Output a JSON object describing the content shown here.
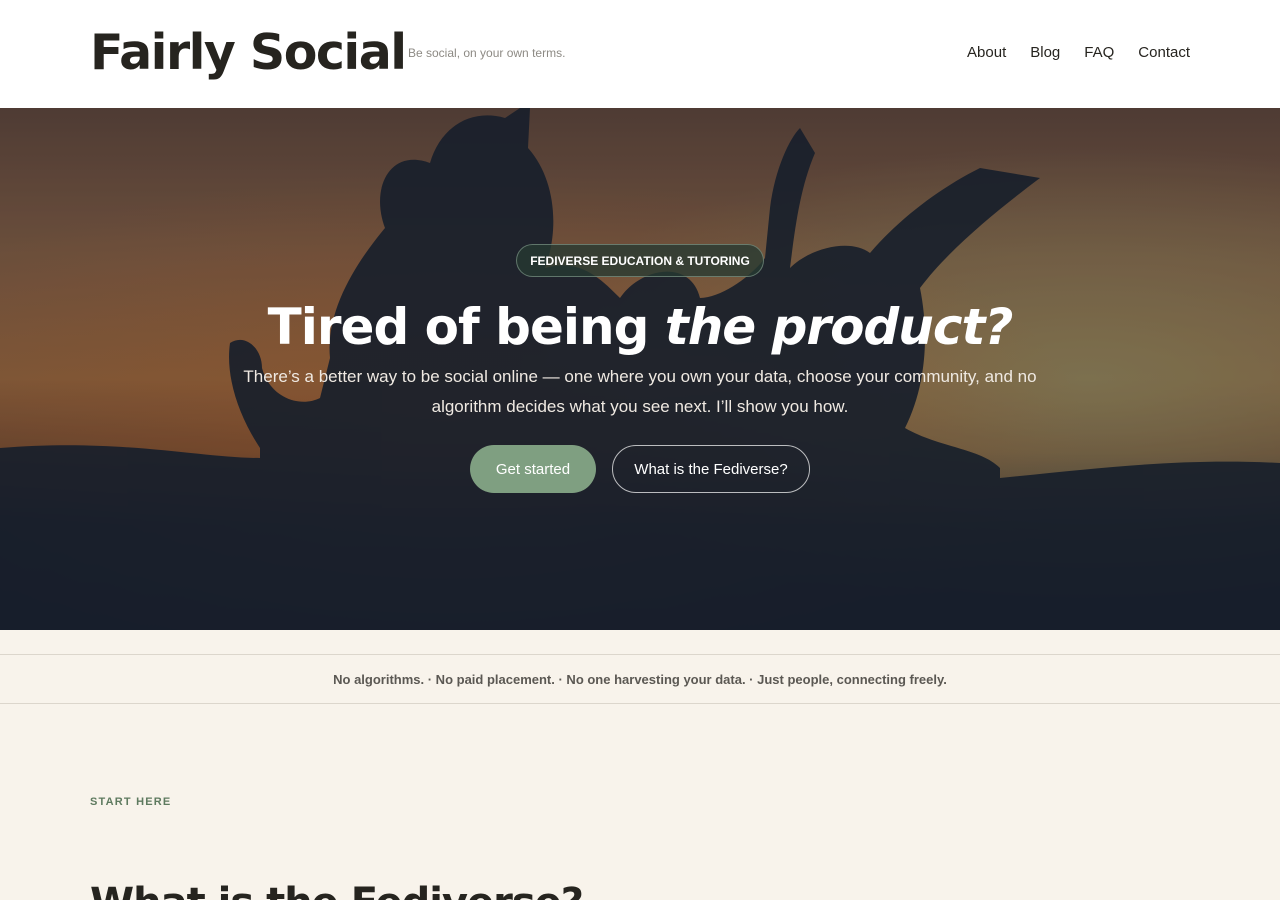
{
  "header": {
    "site_title": "Fairly Social",
    "tagline": "Be social, on your own terms.",
    "nav": [
      {
        "label": "About"
      },
      {
        "label": "Blog"
      },
      {
        "label": "FAQ"
      },
      {
        "label": "Contact"
      }
    ]
  },
  "hero": {
    "eyebrow": "FEDIVERSE EDUCATION & TUTORING",
    "title_plain": "Tired of being ",
    "title_italic": "the product?",
    "lead": "There’s a better way to be social online — one where you own your data, choose your community, and no algorithm decides what you see next. I’ll show you how.",
    "primary_button": "Get started",
    "secondary_button": "What is the Fediverse?",
    "background_image": "silhouettes-sunset-photo"
  },
  "values_strip": {
    "text": "No algorithms. · No paid placement. · No one harvesting your data. · Just people, connecting freely."
  },
  "intro_section": {
    "eyebrow": "START HERE",
    "title": "What is the Fediverse?"
  },
  "colors": {
    "accent": "#7f9f81",
    "header_bg": "#ffffff",
    "page_bg": "#f8f3eb",
    "hero_dark": "#121a26",
    "text": "#26241f"
  }
}
